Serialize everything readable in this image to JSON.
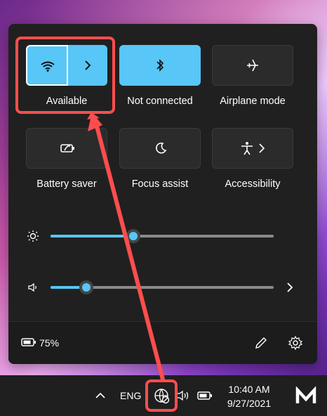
{
  "panel": {
    "tiles": [
      {
        "label": "Available",
        "state": "on"
      },
      {
        "label": "Not connected",
        "state": "on"
      },
      {
        "label": "Airplane mode",
        "state": "off"
      },
      {
        "label": "Battery saver",
        "state": "off"
      },
      {
        "label": "Focus assist",
        "state": "off"
      },
      {
        "label": "Accessibility",
        "state": "off"
      }
    ],
    "sliders": {
      "brightness": {
        "value": 0.37
      },
      "volume": {
        "value": 0.16
      }
    },
    "footer": {
      "battery_percent": "75%"
    }
  },
  "taskbar": {
    "language": "ENG",
    "time": "10:40 AM",
    "date": "9/27/2021"
  },
  "colors": {
    "accent": "#58c6f7",
    "panel": "#202020",
    "annotation": "#ff4d4d"
  }
}
